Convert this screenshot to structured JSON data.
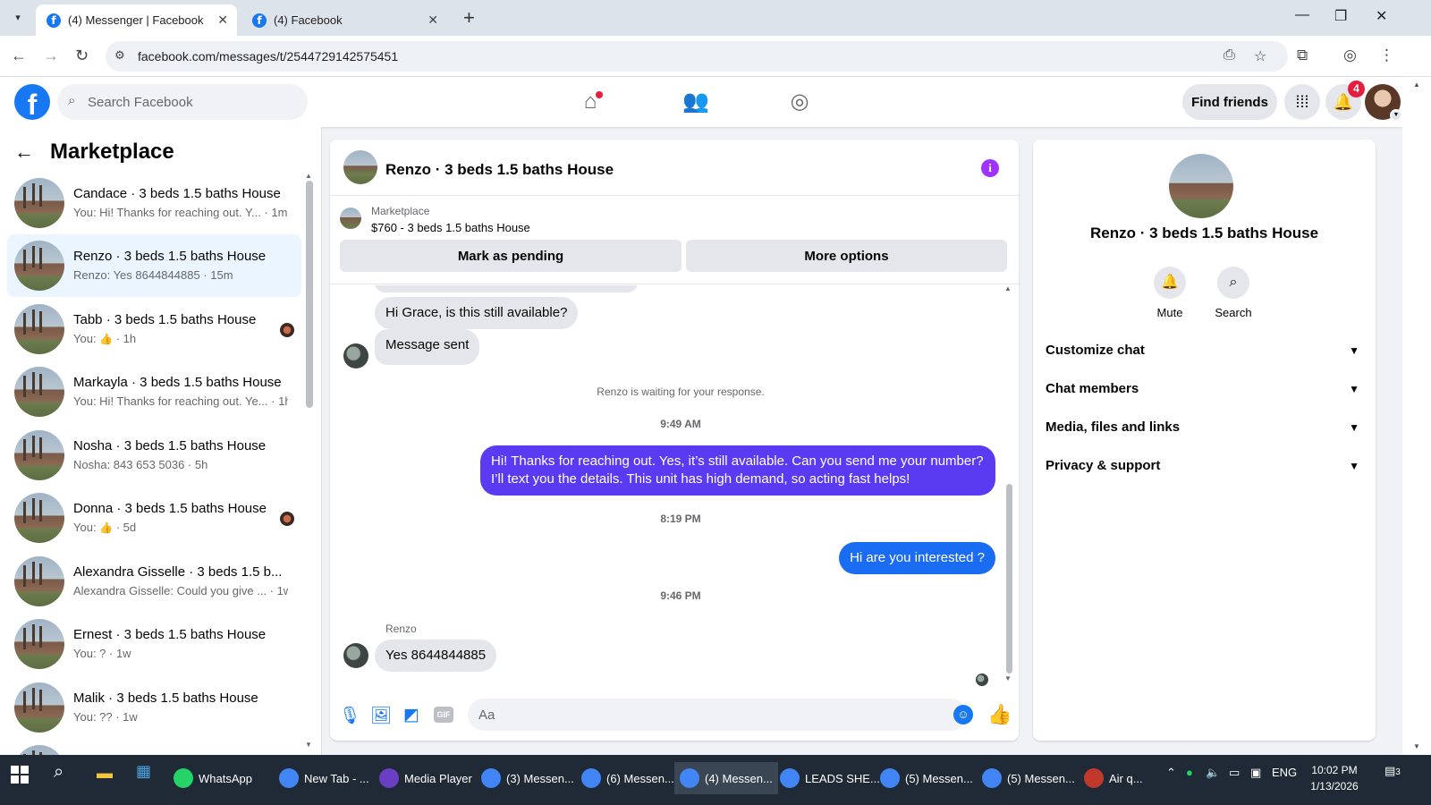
{
  "browser": {
    "tabs": [
      {
        "title": "(4) Messenger | Facebook",
        "active": true
      },
      {
        "title": "(4) Facebook",
        "active": false
      }
    ],
    "url": "facebook.com/messages/t/2544729142575451"
  },
  "header": {
    "search_placeholder": "Search Facebook",
    "find_friends": "Find friends",
    "notif_count": "4",
    "logo": "f"
  },
  "sidebar": {
    "title": "Marketplace",
    "conversations": [
      {
        "name": "Candace · 3 beds 1.5 baths House",
        "preview": "You: Hi! Thanks for reaching out. Y... · 1m",
        "active": false
      },
      {
        "name": "Renzo · 3 beds 1.5 baths House",
        "preview": "Renzo: Yes 8644844885 · 15m",
        "active": true
      },
      {
        "name": "Tabb · 3 beds 1.5 baths House",
        "preview_prefix": "You: ",
        "preview": " · 1h",
        "active": false
      },
      {
        "name": "Markayla · 3 beds 1.5 baths House",
        "preview": "You: Hi! Thanks for reaching out. Ye... · 1h",
        "active": false
      },
      {
        "name": "Nosha · 3 beds 1.5 baths House",
        "preview": "Nosha: 843 653 5036 · 5h",
        "active": false
      },
      {
        "name": "Donna · 3 beds 1.5 baths House",
        "preview_prefix": "You: ",
        "preview": " · 5d",
        "active": false
      },
      {
        "name": "Alexandra Gisselle · 3 beds 1.5 b...",
        "preview": "Alexandra Gisselle: Could you give ... · 1w",
        "active": false
      },
      {
        "name": "Ernest · 3 beds 1.5 baths House",
        "preview": "You: ? · 1w",
        "active": false
      },
      {
        "name": "Malik · 3 beds 1.5 baths House",
        "preview": "You: ?? · 1w",
        "active": false
      }
    ]
  },
  "chat": {
    "title": "Renzo · 3 beds 1.5 baths House",
    "info_icon": "i",
    "marketplace_label": "Marketplace",
    "listing": "$760 - 3 beds 1.5 baths House",
    "mark_pending": "Mark as pending",
    "more_options": "More options",
    "messages": {
      "in1": "Hi Grace, is this still available?",
      "in2": "Message sent",
      "waiting": "Renzo is waiting for your response.",
      "ts1": "9:49 AM",
      "out1": "Hi! Thanks for reaching out. Yes, it’s still available. Can you send me your number? I’ll text you the details. This unit has high demand, so acting fast helps!",
      "ts2": "8:19 PM",
      "out2": "Hi are you interested ?",
      "ts3": "9:46 PM",
      "sender": "Renzo",
      "in3": "Yes 8644844885"
    },
    "composer_placeholder": "Aa",
    "gif": "GIF"
  },
  "info_panel": {
    "name": "Renzo · 3 beds 1.5 baths House",
    "mute": "Mute",
    "search": "Search",
    "rows": [
      "Customize chat",
      "Chat members",
      "Media, files and links",
      "Privacy & support"
    ]
  },
  "taskbar": {
    "items": [
      {
        "label": "WhatsApp",
        "color": "#25d366"
      },
      {
        "label": "New Tab - ...",
        "color": "#4285f4"
      },
      {
        "label": "Media Player",
        "color": "#6a3fc4"
      },
      {
        "label": "(3) Messen...",
        "color": "#4285f4"
      },
      {
        "label": "(6) Messen...",
        "color": "#4285f4"
      },
      {
        "label": "(4) Messen...",
        "color": "#4285f4"
      },
      {
        "label": "LEADS SHE...",
        "color": "#4285f4"
      },
      {
        "label": "(5) Messen...",
        "color": "#4285f4"
      },
      {
        "label": "(5) Messen...",
        "color": "#4285f4"
      },
      {
        "label": "Air q...",
        "color": "#c0392b"
      }
    ],
    "lang": "ENG",
    "time": "10:02 PM",
    "date": "1/13/2026",
    "notif": "3"
  },
  "colors": {
    "fb_blue": "#1877f2",
    "outgoing_purple": "#5b3bf2",
    "outgoing_blue": "#1a6cf2",
    "info_purple": "#a033ff"
  }
}
